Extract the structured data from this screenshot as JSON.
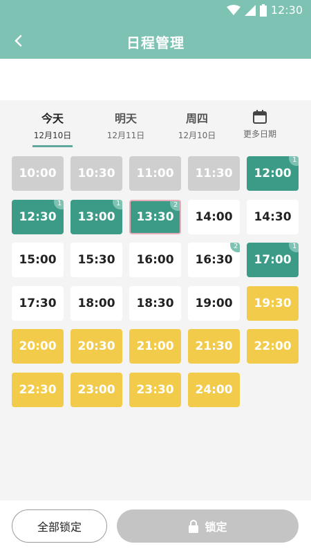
{
  "status_bar": {
    "time": "12:30"
  },
  "header": {
    "title": "日程管理"
  },
  "tabs": [
    {
      "label": "今天",
      "date": "12月10日",
      "active": true
    },
    {
      "label": "明天",
      "date": "12月11日",
      "active": false
    },
    {
      "label": "周四",
      "date": "12月10日",
      "active": false
    },
    {
      "label": "",
      "date": "更多日期",
      "icon": "calendar-icon",
      "active": false
    }
  ],
  "slots": [
    {
      "time": "10:00",
      "state": "disabled"
    },
    {
      "time": "10:30",
      "state": "disabled"
    },
    {
      "time": "11:00",
      "state": "disabled"
    },
    {
      "time": "11:30",
      "state": "disabled"
    },
    {
      "time": "12:00",
      "state": "booked",
      "badge": "1"
    },
    {
      "time": "12:30",
      "state": "booked",
      "badge": "1"
    },
    {
      "time": "13:00",
      "state": "booked",
      "badge": "1"
    },
    {
      "time": "13:30",
      "state": "booked",
      "badge": "2",
      "selected": true
    },
    {
      "time": "14:00",
      "state": "free"
    },
    {
      "time": "14:30",
      "state": "free"
    },
    {
      "time": "15:00",
      "state": "free"
    },
    {
      "time": "15:30",
      "state": "free"
    },
    {
      "time": "16:00",
      "state": "free"
    },
    {
      "time": "16:30",
      "state": "free",
      "badge": "2"
    },
    {
      "time": "17:00",
      "state": "booked",
      "badge": "1"
    },
    {
      "time": "17:30",
      "state": "free"
    },
    {
      "time": "18:00",
      "state": "free"
    },
    {
      "time": "18:30",
      "state": "free"
    },
    {
      "time": "19:00",
      "state": "free"
    },
    {
      "time": "19:30",
      "state": "night"
    },
    {
      "time": "20:00",
      "state": "night"
    },
    {
      "time": "20:30",
      "state": "night"
    },
    {
      "time": "21:00",
      "state": "night"
    },
    {
      "time": "21:30",
      "state": "night"
    },
    {
      "time": "22:00",
      "state": "night"
    },
    {
      "time": "22:30",
      "state": "night"
    },
    {
      "time": "23:00",
      "state": "night"
    },
    {
      "time": "23:30",
      "state": "night"
    },
    {
      "time": "24:00",
      "state": "night"
    }
  ],
  "footer": {
    "lock_all_label": "全部锁定",
    "lock_label": "锁定"
  },
  "colors": {
    "header": "#7ec2b4",
    "booked": "#3b9b87",
    "disabled": "#cfcfcf",
    "night": "#f3cb4b",
    "selected_border": "#e8aab6",
    "lock_button": "#c4c4c4"
  }
}
